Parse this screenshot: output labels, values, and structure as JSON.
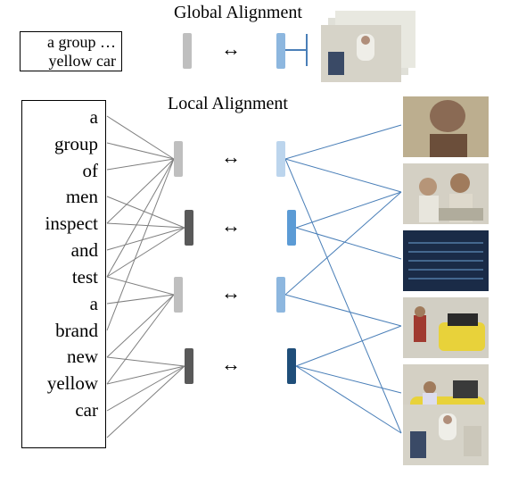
{
  "labels": {
    "global": "Global Alignment",
    "local": "Local Alignment"
  },
  "global_text": {
    "line1": "a group …",
    "line2": "yellow car"
  },
  "words": [
    "a",
    "group",
    "of",
    "men",
    "inspect",
    "and",
    "test",
    "a",
    "brand",
    "new",
    "yellow",
    "car"
  ],
  "arrows": {
    "double": "↔"
  },
  "caption": "  ",
  "icons": {
    "double_arrow": "double-arrow-icon"
  }
}
